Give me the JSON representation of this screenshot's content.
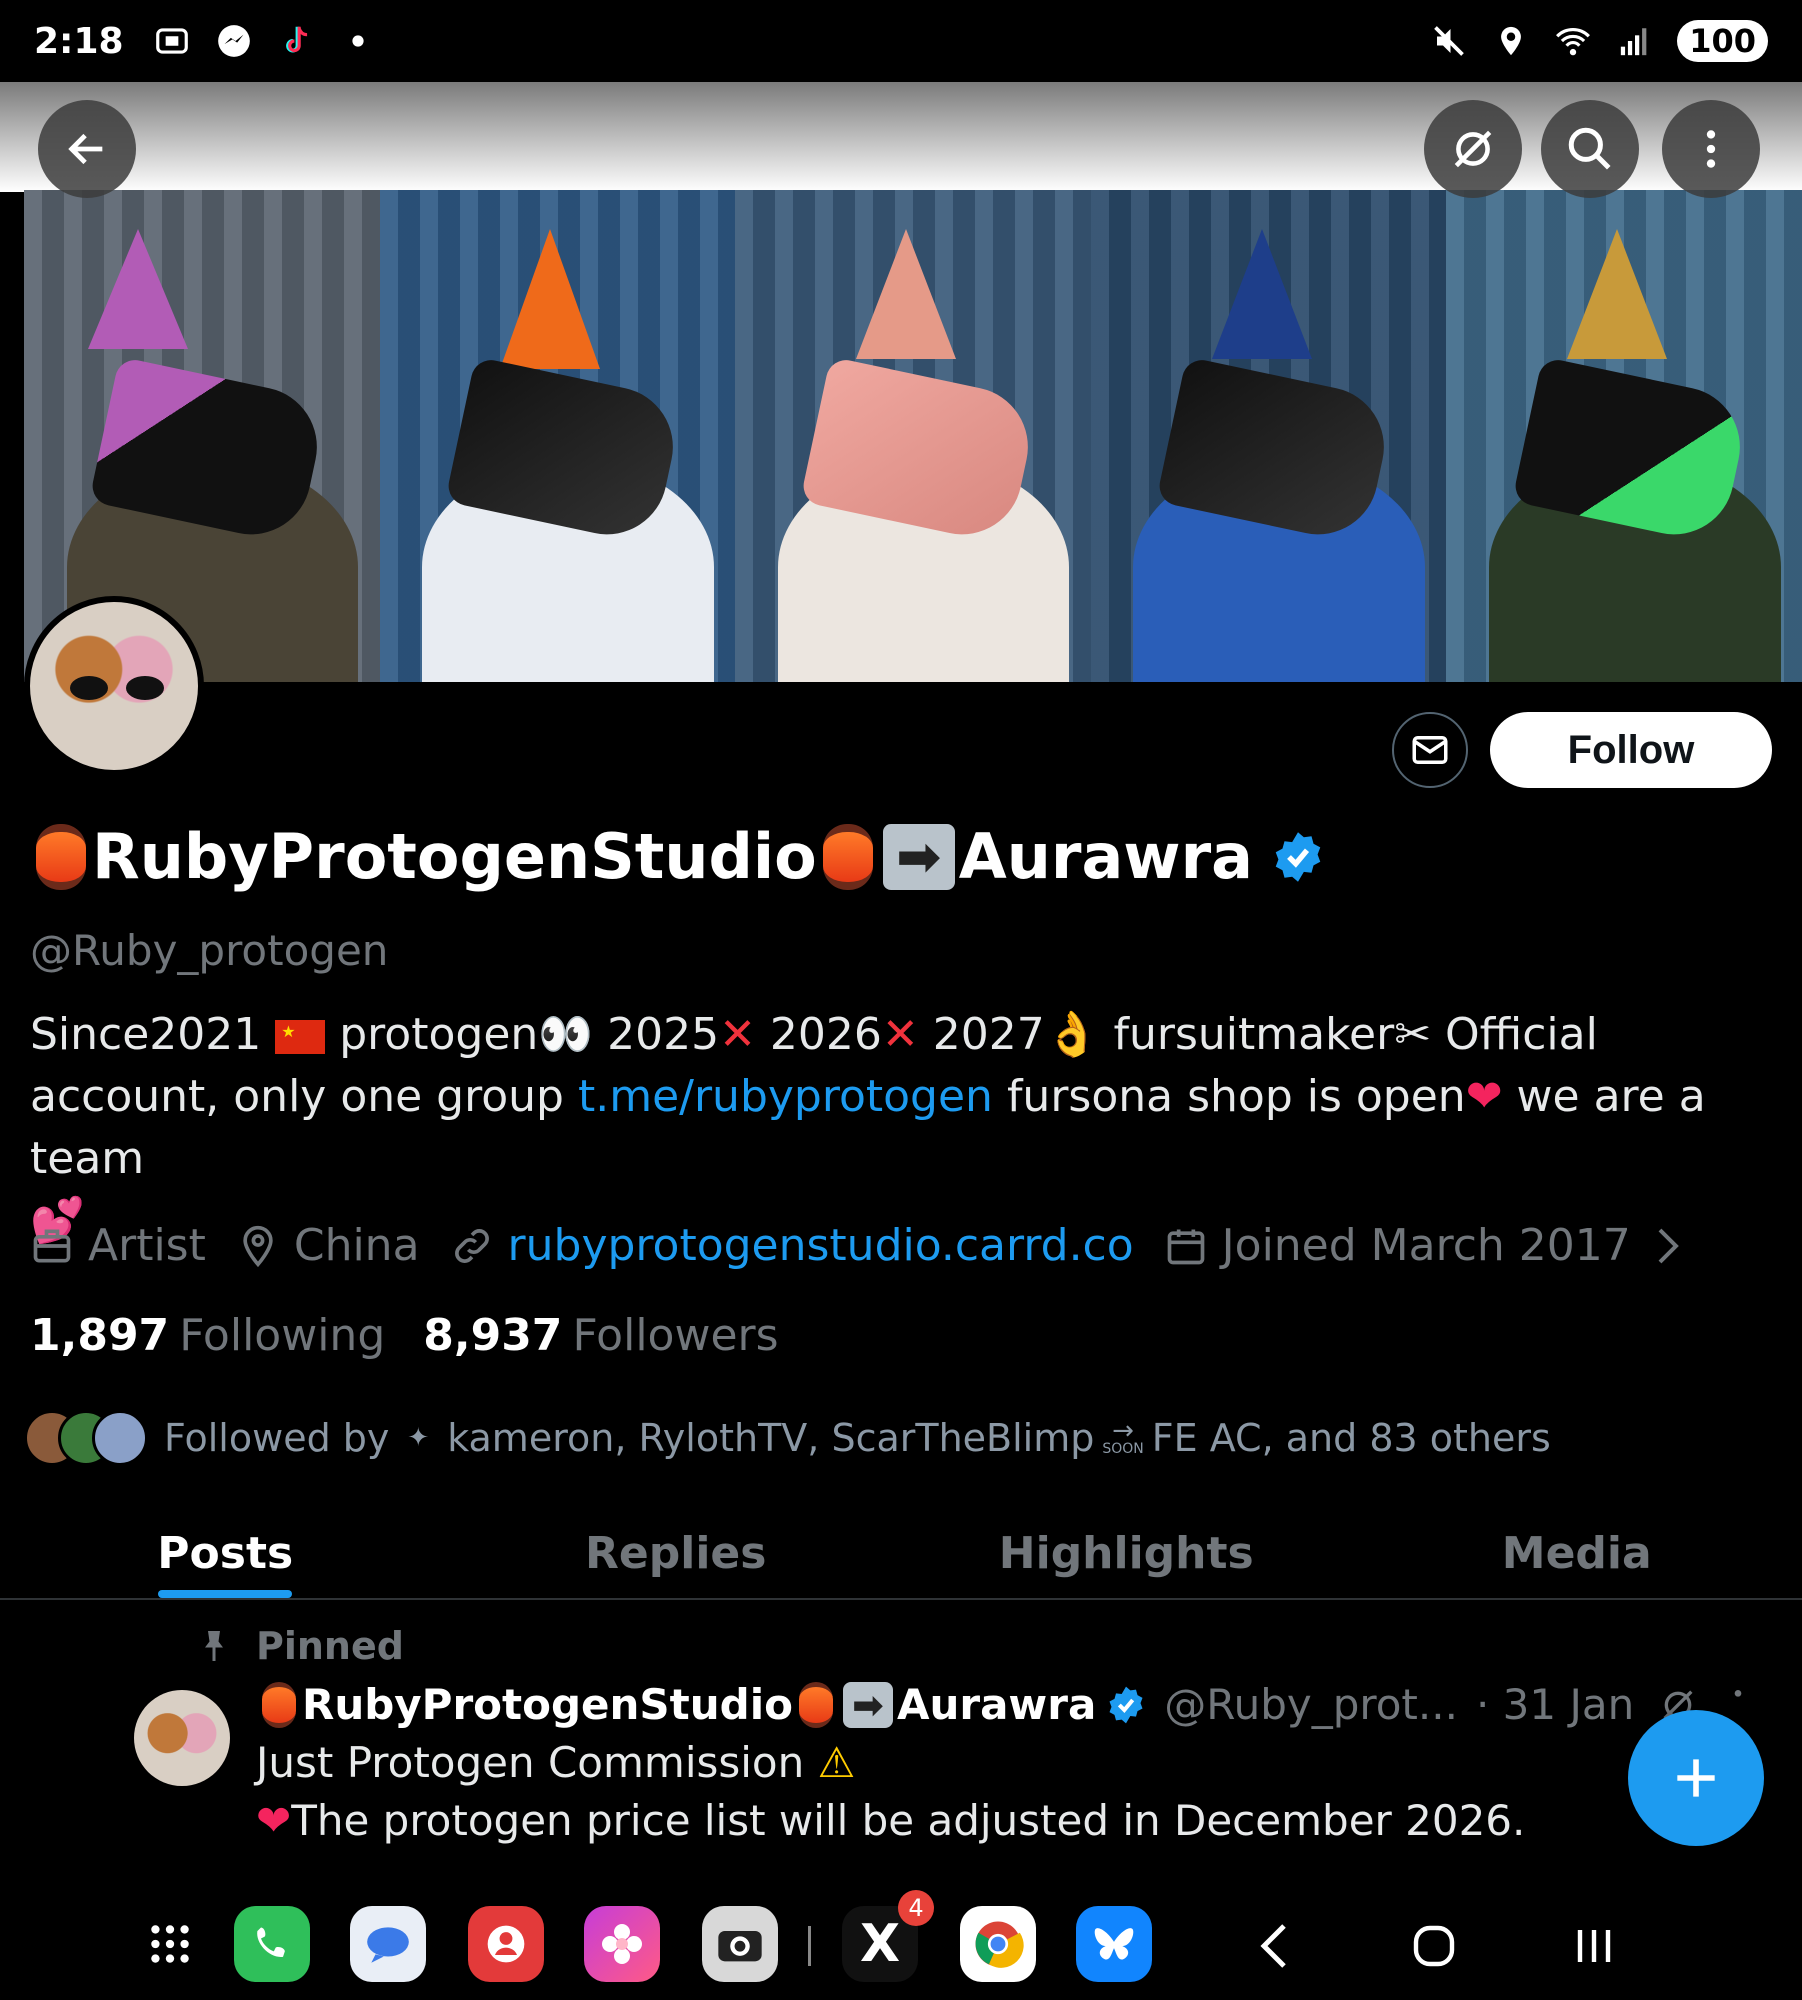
{
  "status_bar": {
    "time": "2:18",
    "battery": "100",
    "icons_left": [
      "screenshot-icon",
      "messenger-icon",
      "tiktok-icon",
      "dot-icon"
    ],
    "icons_right": [
      "mute-icon",
      "location-icon",
      "wifi-icon",
      "signal-icon"
    ]
  },
  "header": {
    "back_icon": "arrow-left-icon",
    "grok_icon": "grok-icon",
    "search_icon": "search-icon",
    "more_icon": "more-vertical-icon"
  },
  "profile": {
    "name": "RubyProtogenStudio",
    "name_suffix": "Aurawra",
    "handle": "@Ruby_protogen",
    "verified": true,
    "follow_label": "Follow",
    "bio": {
      "part1": "Since2021 ",
      "part2": " protogen",
      "part3": "  2025",
      "part4": " 2026",
      "part5": " 2027",
      "part6": "  fursuitmaker",
      "part7": " Official account, only one  group ",
      "link": "t.me/rubyprotogen",
      "part8": " fursona shop is open",
      "part9": " we are a team"
    },
    "meta": {
      "category": "Artist",
      "location": "China",
      "website": "rubyprotogenstudio.carrd.co",
      "joined": "Joined March 2017"
    },
    "following_count": "1,897",
    "following_label": "Following",
    "followers_count": "8,937",
    "followers_label": "Followers",
    "followed_by": {
      "prefix": "Followed by",
      "names": "kameron, RylothTV, ScarTheBlimp",
      "soon": "SOON",
      "rest": "FE AC, and 83 others"
    }
  },
  "tabs": [
    {
      "label": "Posts",
      "active": true
    },
    {
      "label": "Replies",
      "active": false
    },
    {
      "label": "Highlights",
      "active": false
    },
    {
      "label": "Media",
      "active": false
    }
  ],
  "pinned_post": {
    "pinned_label": "Pinned",
    "author": "RubyProtogenStudio",
    "author_suffix": "Aurawra",
    "handle": "@Ruby_prot...",
    "date": "· 31 Jan",
    "line1": "Just Protogen Commission ",
    "line2": "The protogen price list will be adjusted in December 2026."
  },
  "dock": {
    "apps": [
      "apps-grid-icon",
      "phone-icon",
      "messages-icon",
      "contacts-icon",
      "gallery-icon",
      "camera-icon",
      "x-icon",
      "chrome-icon",
      "bluesky-icon"
    ],
    "x_badge": "4",
    "nav": [
      "back-nav-icon",
      "home-nav-icon",
      "recents-nav-icon"
    ]
  },
  "colors": {
    "accent": "#1d9bf0",
    "muted": "#71767b",
    "background": "#000000"
  }
}
